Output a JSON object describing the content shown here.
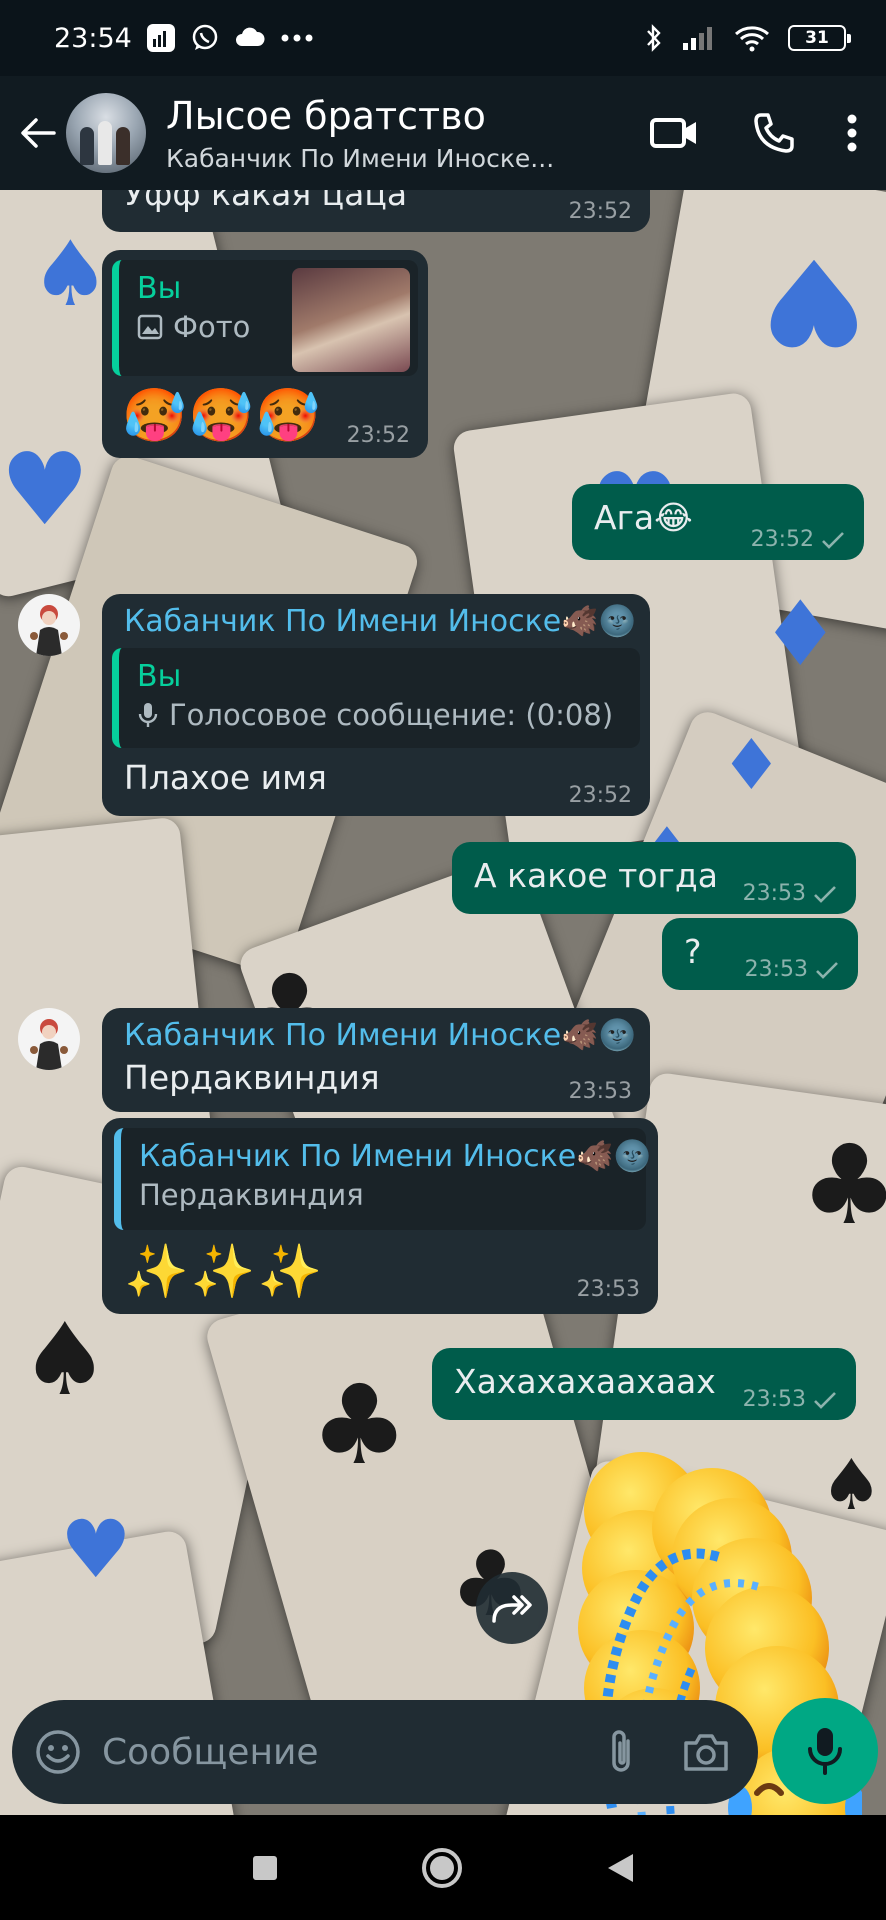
{
  "status_bar": {
    "time": "23:54",
    "battery": "31"
  },
  "header": {
    "title": "Лысое братство",
    "subtitle": "Кабанчик По Имени Иноске..."
  },
  "messages": {
    "m1": {
      "text": "Уфф какая цаца",
      "time": "23:52"
    },
    "m2": {
      "quote_author": "Вы",
      "quote_text": "Фото",
      "emojis": "🥵🥵🥵",
      "time": "23:52"
    },
    "m3": {
      "text": "Ага😂",
      "time": "23:52"
    },
    "m4": {
      "sender": "Кабанчик По Имени Иноске🐗🌚",
      "quote_author": "Вы",
      "quote_text": "Голосовое сообщение: (0:08)",
      "text": "Плахое имя",
      "time": "23:52"
    },
    "m5": {
      "text": "А какое тогда",
      "time": "23:53"
    },
    "m6": {
      "text": "?",
      "time": "23:53"
    },
    "m7": {
      "sender": "Кабанчик По Имени Иноске🐗🌚",
      "text": "Пердаквиндия",
      "time": "23:53"
    },
    "m8": {
      "quote_author": "Кабанчик По Имени Иноске🐗🌚",
      "quote_text": "Пердаквиндия",
      "emojis": "✨✨✨",
      "time": "23:53"
    },
    "m9": {
      "text": "Хахахахаахаах",
      "time": "23:53"
    }
  },
  "sticker": {
    "emoji": "😂"
  },
  "composer": {
    "placeholder": "Сообщение"
  },
  "colors": {
    "incoming": "#202c33",
    "outgoing": "#005c4b",
    "accent": "#00a884",
    "sender": "#53bdeb"
  }
}
